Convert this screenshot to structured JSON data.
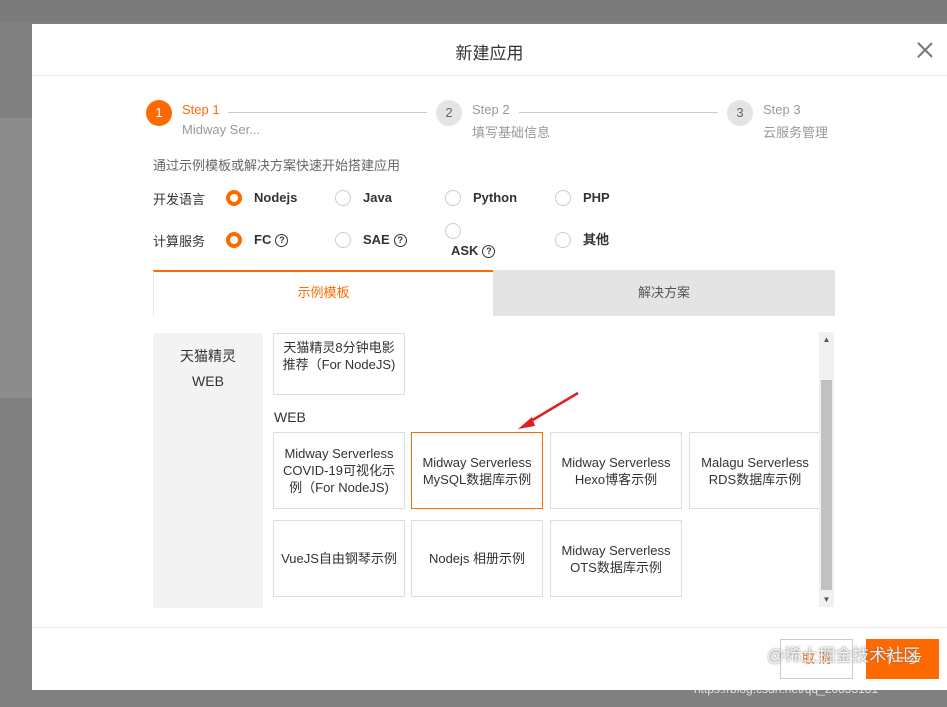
{
  "dialog": {
    "title": "新建应用"
  },
  "steps": [
    {
      "number": "1",
      "title": "Step 1",
      "desc": "Midway Ser..."
    },
    {
      "number": "2",
      "title": "Step 2",
      "desc": "填写基础信息"
    },
    {
      "number": "3",
      "title": "Step 3",
      "desc": "云服务管理"
    }
  ],
  "intro_text": "通过示例模板或解决方案快速开始搭建应用",
  "language": {
    "label": "开发语言",
    "options": [
      "Nodejs",
      "Java",
      "Python",
      "PHP"
    ],
    "selected": "Nodejs"
  },
  "compute": {
    "label": "计算服务",
    "options": [
      "FC",
      "SAE",
      "ASK",
      "其他"
    ],
    "selected": "FC",
    "help_icon": "?"
  },
  "tabs": [
    "示例模板",
    "解决方案"
  ],
  "sidebar": [
    "天猫精灵",
    "WEB"
  ],
  "templates": {
    "top": "天猫精灵8分钟电影推荐（For NodeJS)",
    "web_label": "WEB",
    "web": [
      "Midway Serverless COVID-19可视化示例（For NodeJS)",
      "Midway Serverless MySQL数据库示例",
      "Midway Serverless Hexo博客示例",
      "Malagu Serverless RDS数据库示例",
      "VueJS自由钢琴示例",
      "Nodejs 相册示例",
      "Midway Serverless OTS数据库示例"
    ]
  },
  "footer": {
    "cancel": "取 消",
    "next": "下一步"
  },
  "watermark": {
    "text": "@稀土掘金技术社区",
    "url": "https://blog.csdn.net/qq_20855181"
  },
  "colors": {
    "accent": "#ff6a00",
    "arrow": "#e02020"
  },
  "icons": {
    "close": "close-icon",
    "help": "help-circle-icon",
    "scroll_up": "triangle-up-icon",
    "scroll_down": "triangle-down-icon"
  }
}
